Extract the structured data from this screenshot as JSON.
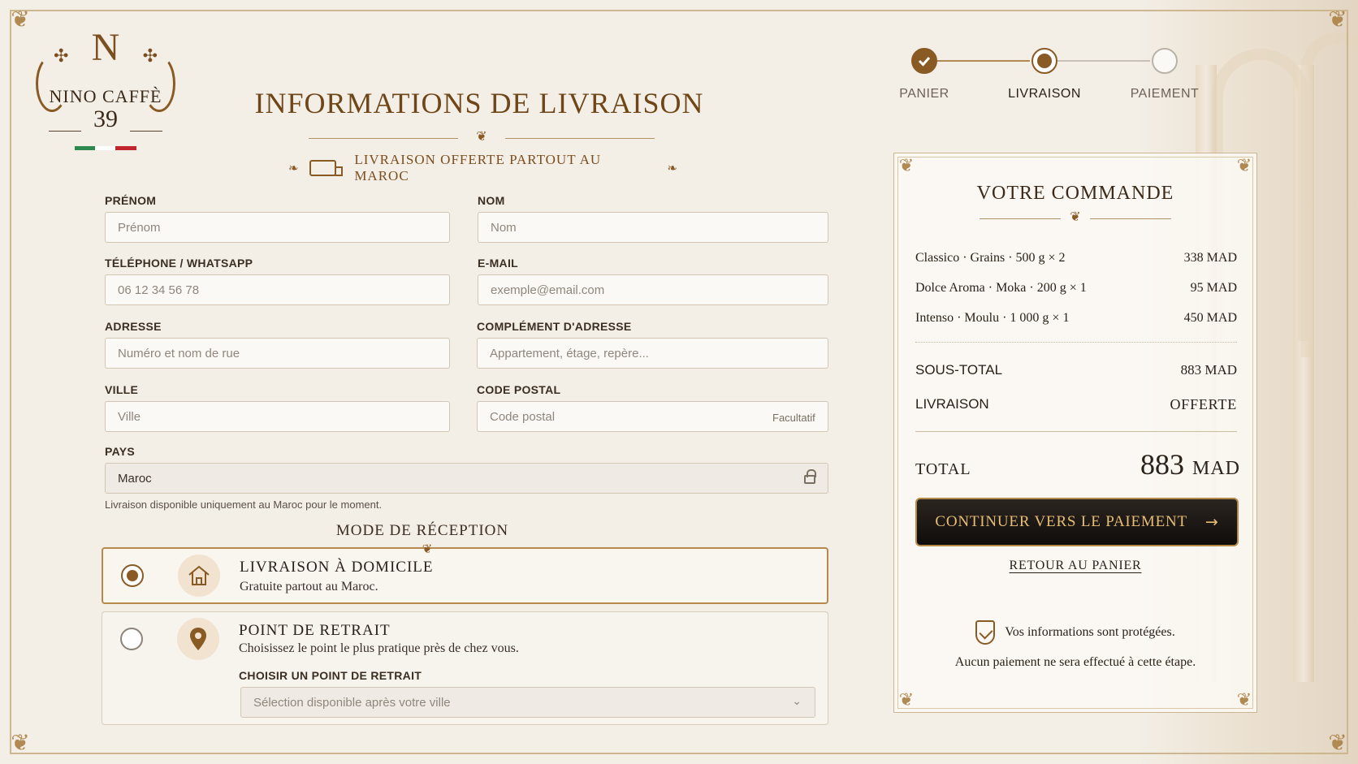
{
  "brand": {
    "initial": "N",
    "name": "NINO CAFFÈ",
    "number": "39"
  },
  "title": "INFORMATIONS DE LIVRAISON",
  "promo": "LIVRAISON OFFERTE PARTOUT AU MAROC",
  "steps": [
    {
      "label": "PANIER",
      "state": "done"
    },
    {
      "label": "LIVRAISON",
      "state": "current"
    },
    {
      "label": "PAIEMENT",
      "state": "todo"
    }
  ],
  "form": {
    "first_name": {
      "label": "PRÉNOM",
      "placeholder": "Prénom"
    },
    "last_name": {
      "label": "NOM",
      "placeholder": "Nom"
    },
    "phone": {
      "label": "TÉLÉPHONE / WHATSAPP",
      "placeholder": "06 12 34 56 78"
    },
    "email": {
      "label": "E-MAIL",
      "placeholder": "exemple@email.com"
    },
    "address": {
      "label": "ADRESSE",
      "placeholder": "Numéro et nom de rue"
    },
    "address2": {
      "label": "COMPLÉMENT D'ADRESSE",
      "placeholder": "Appartement, étage, repère..."
    },
    "city": {
      "label": "VILLE",
      "placeholder": "Ville"
    },
    "postal": {
      "label": "CODE POSTAL",
      "placeholder": "Code postal",
      "hint": "Facultatif"
    },
    "country": {
      "label": "PAYS",
      "value": "Maroc"
    },
    "country_note": "Livraison disponible uniquement au Maroc pour le moment."
  },
  "reception": {
    "title": "MODE DE RÉCEPTION",
    "options": [
      {
        "title": "LIVRAISON À DOMICILE",
        "subtitle": "Gratuite partout au Maroc.",
        "selected": true
      },
      {
        "title": "POINT DE RETRAIT",
        "subtitle": "Choisissez le point le plus pratique près de chez vous.",
        "selected": false,
        "select_label": "CHOISIR UN POINT DE RETRAIT",
        "select_placeholder": "Sélection disponible après votre ville"
      }
    ]
  },
  "summary": {
    "title": "VOTRE COMMANDE",
    "items": [
      {
        "name": "Classico · Grains · 500 g  ×  2",
        "price": "338 MAD"
      },
      {
        "name": "Dolce Aroma · Moka · 200 g  ×  1",
        "price": "95 MAD"
      },
      {
        "name": "Intenso · Moulu · 1 000 g  ×  1",
        "price": "450 MAD"
      }
    ],
    "subtotal_label": "SOUS-TOTAL",
    "subtotal": "883 MAD",
    "shipping_label": "LIVRAISON",
    "shipping": "OFFERTE",
    "total_label": "TOTAL",
    "total_amount": "883",
    "total_currency": "MAD",
    "cta": "CONTINUER VERS LE PAIEMENT",
    "back": "RETOUR AU PANIER",
    "secure_1": "Vos informations sont protégées.",
    "secure_2": "Aucun paiement ne sera effectué à cette étape."
  },
  "colors": {
    "accent": "#8a5a25",
    "background": "#f3eee6",
    "cta_bg": "#1a1512",
    "cta_text": "#e7be74"
  }
}
